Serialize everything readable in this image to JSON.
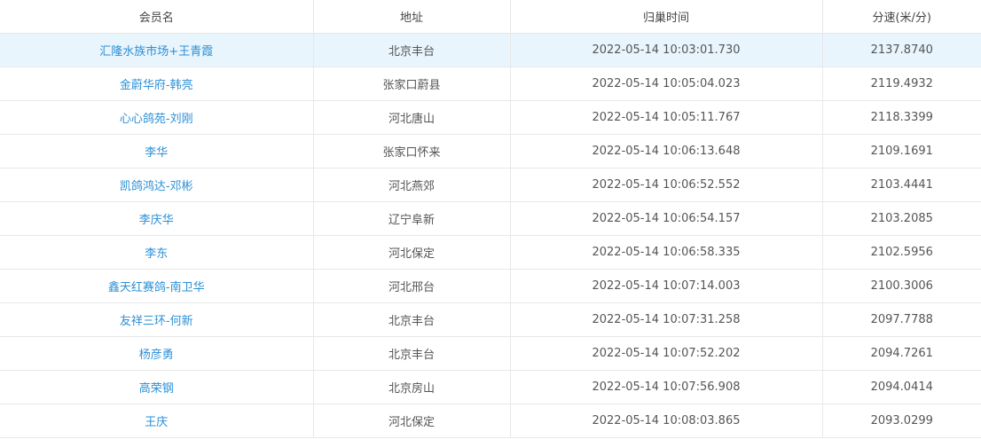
{
  "table": {
    "columns": [
      "会员名",
      "地址",
      "归巢时间",
      "分速(米/分)"
    ],
    "rows": [
      {
        "member": "汇隆水族市场+王青霞",
        "address": "北京丰台",
        "time": "2022-05-14 10:03:01.730",
        "speed": "2137.8740"
      },
      {
        "member": "金蔚华府-韩亮",
        "address": "张家口蔚县",
        "time": "2022-05-14 10:05:04.023",
        "speed": "2119.4932"
      },
      {
        "member": "心心鸽苑-刘刚",
        "address": "河北唐山",
        "time": "2022-05-14 10:05:11.767",
        "speed": "2118.3399"
      },
      {
        "member": "李华",
        "address": "张家口怀来",
        "time": "2022-05-14 10:06:13.648",
        "speed": "2109.1691"
      },
      {
        "member": "凯鸽鸿达-邓彬",
        "address": "河北燕郊",
        "time": "2022-05-14 10:06:52.552",
        "speed": "2103.4441"
      },
      {
        "member": "李庆华",
        "address": "辽宁阜新",
        "time": "2022-05-14 10:06:54.157",
        "speed": "2103.2085"
      },
      {
        "member": "李东",
        "address": "河北保定",
        "time": "2022-05-14 10:06:58.335",
        "speed": "2102.5956"
      },
      {
        "member": "鑫天红赛鸽-南卫华",
        "address": "河北邢台",
        "time": "2022-05-14 10:07:14.003",
        "speed": "2100.3006"
      },
      {
        "member": "友祥三环-何新",
        "address": "北京丰台",
        "time": "2022-05-14 10:07:31.258",
        "speed": "2097.7788"
      },
      {
        "member": "杨彦勇",
        "address": "北京丰台",
        "time": "2022-05-14 10:07:52.202",
        "speed": "2094.7261"
      },
      {
        "member": "高荣钢",
        "address": "北京房山",
        "time": "2022-05-14 10:07:56.908",
        "speed": "2094.0414"
      },
      {
        "member": "王庆",
        "address": "河北保定",
        "time": "2022-05-14 10:08:03.865",
        "speed": "2093.0299"
      }
    ]
  },
  "colors": {
    "link": "#2b8fd6",
    "highlight_row": "#e8f5fd",
    "border": "#e8e8e8",
    "text": "#555555"
  }
}
